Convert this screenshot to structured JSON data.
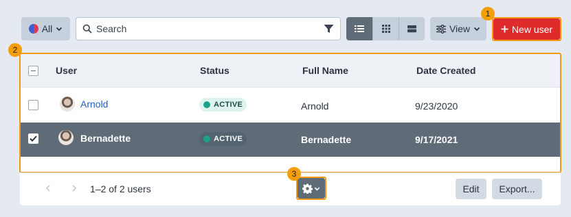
{
  "toolbar": {
    "filter_label": "All",
    "search_placeholder": "Search",
    "view_label": "View",
    "new_user_label": "New user"
  },
  "badges": [
    "1",
    "2",
    "3"
  ],
  "table": {
    "columns": [
      "User",
      "Status",
      "Full Name",
      "Date Created"
    ],
    "rows": [
      {
        "user": "Arnold",
        "status": "ACTIVE",
        "full_name": "Arnold",
        "date_created": "9/23/2020",
        "selected": false
      },
      {
        "user": "Bernadette",
        "status": "ACTIVE",
        "full_name": "Bernadette",
        "date_created": "9/17/2021",
        "selected": true
      }
    ]
  },
  "footer": {
    "range_text": "1–2 of 2 users",
    "edit_label": "Edit",
    "export_label": "Export..."
  },
  "colors": {
    "accent_highlight": "#f29913",
    "new_user_button": "#e02b2b",
    "status_active": "#1aa38a",
    "selected_row": "#5f6b76"
  },
  "icons": [
    "multicolor-dot-icon",
    "chevron-down-icon",
    "search-icon",
    "filter-icon",
    "list-view-icon",
    "grid-view-icon",
    "card-view-icon",
    "sliders-icon",
    "plus-icon",
    "gear-icon",
    "chevron-left-icon",
    "chevron-right-icon",
    "checkbox-icon"
  ]
}
